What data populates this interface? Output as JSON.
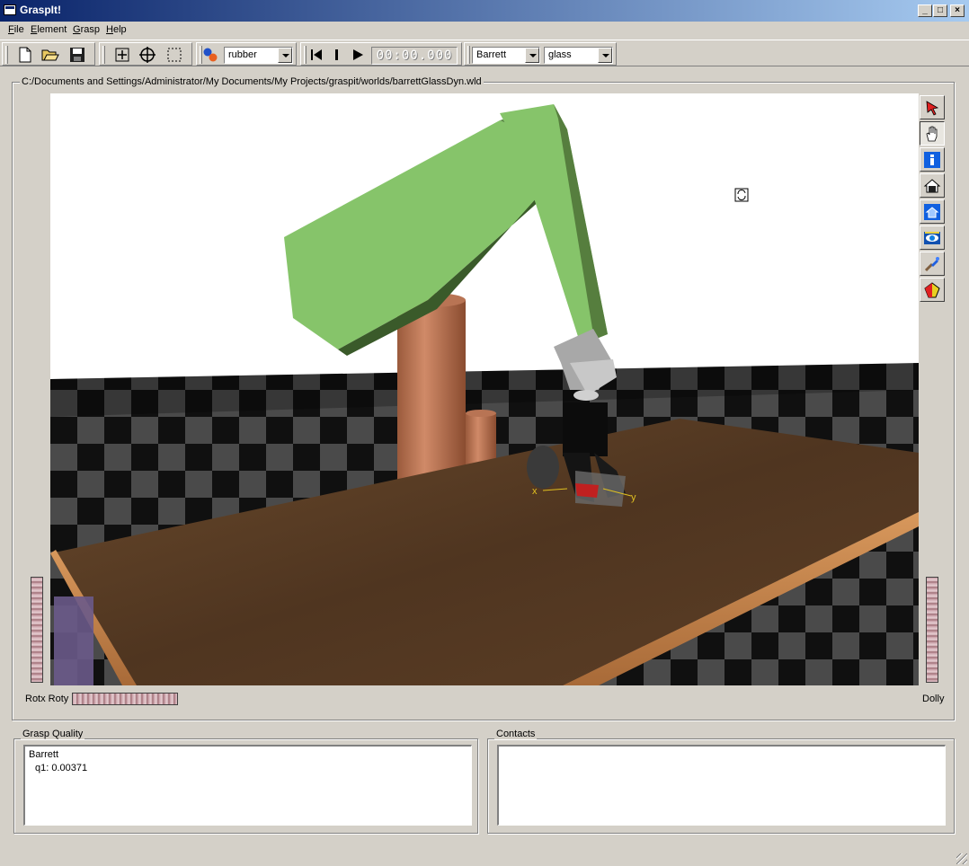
{
  "window": {
    "title": "GraspIt!"
  },
  "window_controls": {
    "minimize": "_",
    "maximize": "□",
    "close": "×"
  },
  "menu": [
    {
      "label": "File",
      "mnemonic": "F",
      "rest": "ile"
    },
    {
      "label": "Element",
      "mnemonic": "E",
      "rest": "lement"
    },
    {
      "label": "Grasp",
      "mnemonic": "G",
      "rest": "rasp"
    },
    {
      "label": "Help",
      "mnemonic": "H",
      "rest": "elp"
    }
  ],
  "toolbar": {
    "buttons": [
      "new-file-icon",
      "open-folder-icon",
      "save-icon",
      "translate-tool-icon",
      "rotate-tool-icon",
      "select-box-icon"
    ],
    "material_select": "rubber",
    "timer": "00:00.000",
    "hand_select": "Barrett",
    "object_select": "glass"
  },
  "world_path": "C:/Documents and Settings/Administrator/My Documents/My Projects/graspit/worlds/barrettGlassDyn.wld",
  "viewer": {
    "side_tools": [
      "pick-arrow-icon",
      "hand-pan-icon",
      "info-icon",
      "home-icon",
      "set-home-icon",
      "view-all-icon",
      "seek-icon",
      "perspective-icon"
    ],
    "axes": {
      "x": "x",
      "y": "y"
    },
    "thumbwheels": {
      "rot_label": "Rotx Roty",
      "dolly_label": "Dolly"
    }
  },
  "grasp_quality": {
    "title": "Grasp Quality",
    "lines": [
      "Barrett",
      "q1: 0.00371"
    ]
  },
  "contacts": {
    "title": "Contacts",
    "lines": []
  },
  "colors": {
    "robot_green": "#86c46a",
    "base_copper": "#c07a58",
    "table_wood": "#5a3c22",
    "title_blue": "#0a246a"
  }
}
